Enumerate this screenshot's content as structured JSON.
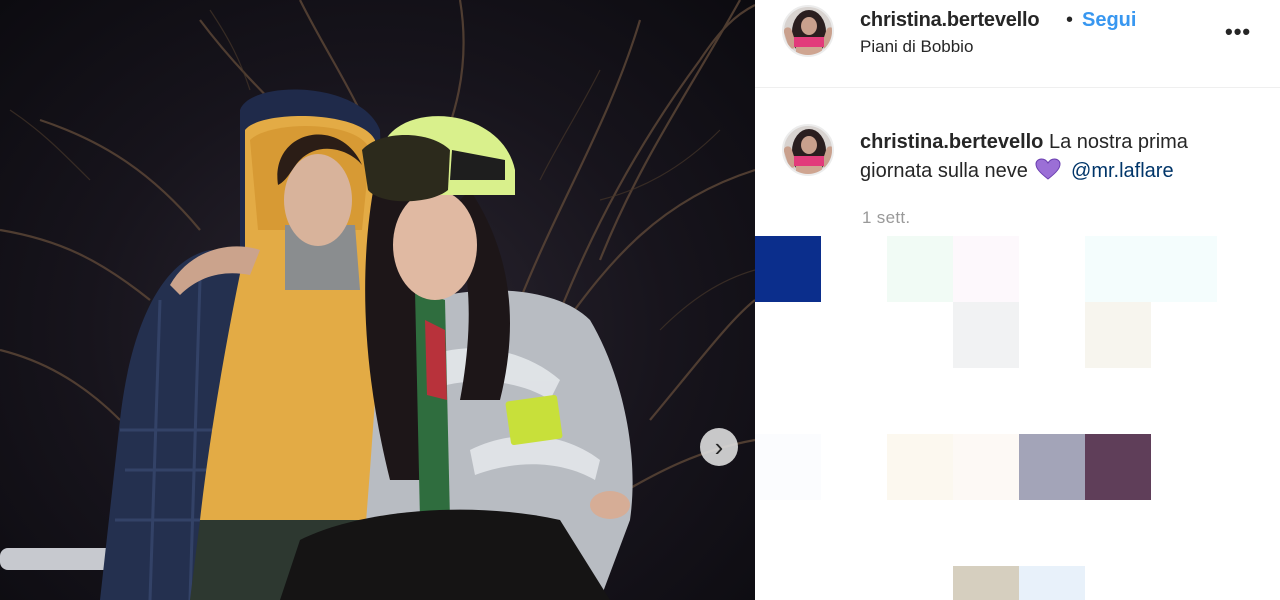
{
  "post": {
    "username": "christina.bertevello",
    "separator": "•",
    "follow_label": "Segui",
    "location": "Piani di Bobbio",
    "more_icon": "more-horizontal-icon",
    "more_label": "•••"
  },
  "caption": {
    "username": "christina.bertevello",
    "text": "La nostra prima giornata sulla neve",
    "emoji": "purple-heart",
    "mention": "@mr.laflare",
    "timestamp": "1 sett."
  },
  "carousel": {
    "next_icon": "chevron-right-icon",
    "next_label": "›"
  },
  "colors": {
    "follow_blue": "#3897f0",
    "mention_blue": "#003569",
    "timestamp_gray": "#999999",
    "heart_purple": "#9b6fd6"
  },
  "tiles": [
    {
      "color": "#0b2e8c"
    },
    {
      "color": "#f1fbf5"
    },
    {
      "color": "#fdf8fc"
    },
    {
      "color": "#f4fdfd"
    },
    {
      "color": "#f4fdfd"
    },
    {
      "color": "#f1f2f3"
    },
    {
      "color": "#f7f5ee"
    },
    {
      "color": "#fbfcfe"
    },
    {
      "color": "#fcf8ef"
    },
    {
      "color": "#fdf9f5"
    },
    {
      "color": "#a3a4b8"
    },
    {
      "color": "#5f3e59"
    },
    {
      "color": "#d6cfbf"
    },
    {
      "color": "#e8f1fa"
    }
  ]
}
